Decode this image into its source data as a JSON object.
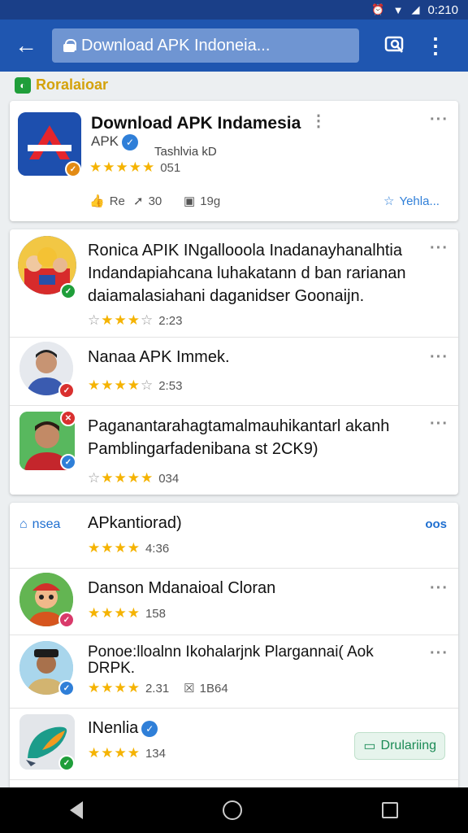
{
  "status_bar": {
    "time": "0:210"
  },
  "app_bar": {
    "url": "Download APK Indoneia..."
  },
  "section_label": "Roralaioar",
  "featured": {
    "title": "Download APK Indamesia",
    "subtitle": "APK",
    "developer": "Tashlvia kD",
    "rating_text": "051",
    "actions": {
      "like": "Re",
      "share": "30",
      "size": "19g",
      "save": "Yehla..."
    }
  },
  "list1": [
    {
      "title_lines": [
        "Ronica APIK INgallooola Inadanayhanalhtia",
        "Indandapiahcana luhakatann d ban rarianan",
        "daiamalasiahani daganidser Goonaijn."
      ],
      "rating": "2:23"
    },
    {
      "title_lines": [
        "Nanaa APK Immek."
      ],
      "rating": "2:53"
    },
    {
      "title_lines": [
        "Paganantarahagtamalmauhikantarl akanh",
        "Pamblingarfadenibana st 2CK9)"
      ],
      "rating": "034"
    }
  ],
  "list2_header": {
    "tag": "nsea",
    "title": "APkantiorad)",
    "rating": "4:36",
    "link": "oos"
  },
  "list2": [
    {
      "title_lines": [
        "Danson Mdanaioal Cloran"
      ],
      "rating": "158"
    },
    {
      "title_lines": [
        "Ponoe:lloalnn Ikohalarjnk Plargannai( Aok",
        "DRPK."
      ],
      "rating": "2.31",
      "extra": "1B64"
    },
    {
      "title_lines": [
        "INenlia"
      ],
      "rating": "134",
      "button": "Drulariing"
    }
  ]
}
